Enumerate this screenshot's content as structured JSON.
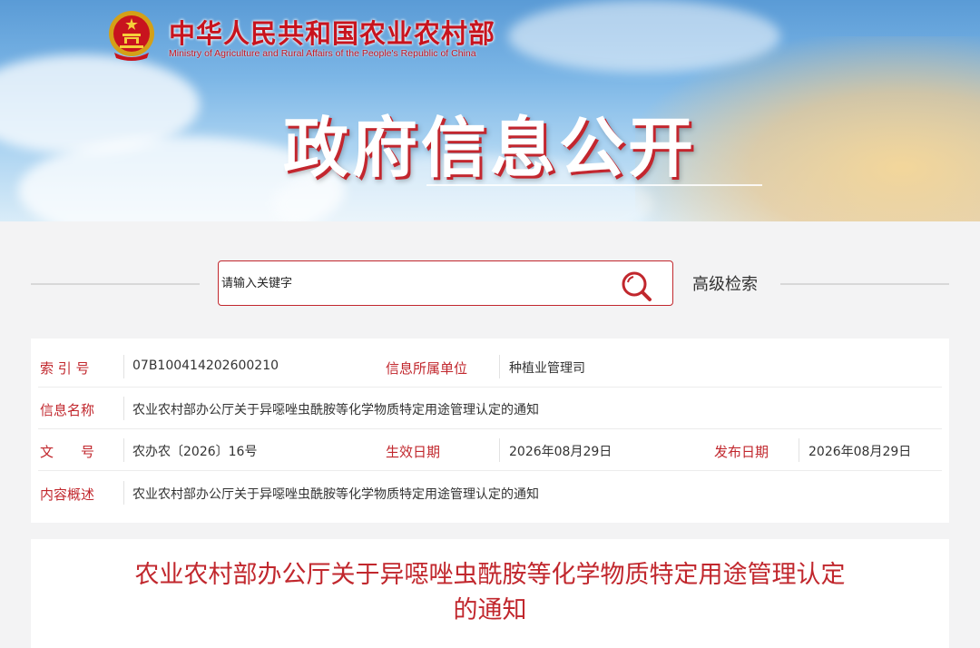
{
  "header": {
    "site_name_cn": "中华人民共和国农业农村部",
    "site_name_en": "Ministry of Agriculture and Rural Affairs of the People's Republic of China",
    "banner_title": "政府信息公开"
  },
  "search": {
    "placeholder": "请输入关键字",
    "advanced_label": "高级检索"
  },
  "info": {
    "index_label": "索 引 号",
    "index_value": "07B100414202600210",
    "unit_label": "信息所属单位",
    "unit_value": "种植业管理司",
    "name_label": "信息名称",
    "name_value": "农业农村部办公厅关于异噁唑虫酰胺等化学物质特定用途管理认定的通知",
    "doc_label": "文　　号",
    "doc_value": "农办农〔2026〕16号",
    "effective_label": "生效日期",
    "effective_value": "2026年08月29日",
    "publish_label": "发布日期",
    "publish_value": "2026年08月29日",
    "summary_label": "内容概述",
    "summary_value": "农业农村部办公厅关于异噁唑虫酰胺等化学物质特定用途管理认定的通知"
  },
  "article": {
    "title_line1": "农业农村部办公厅关于异噁唑虫酰胺等化学物质特定用途管理认定",
    "title_line2": "的通知"
  },
  "colors": {
    "accent_red": "#c1272d",
    "sky_blue": "#7cb6e6",
    "page_bg": "#f3f3f4"
  }
}
